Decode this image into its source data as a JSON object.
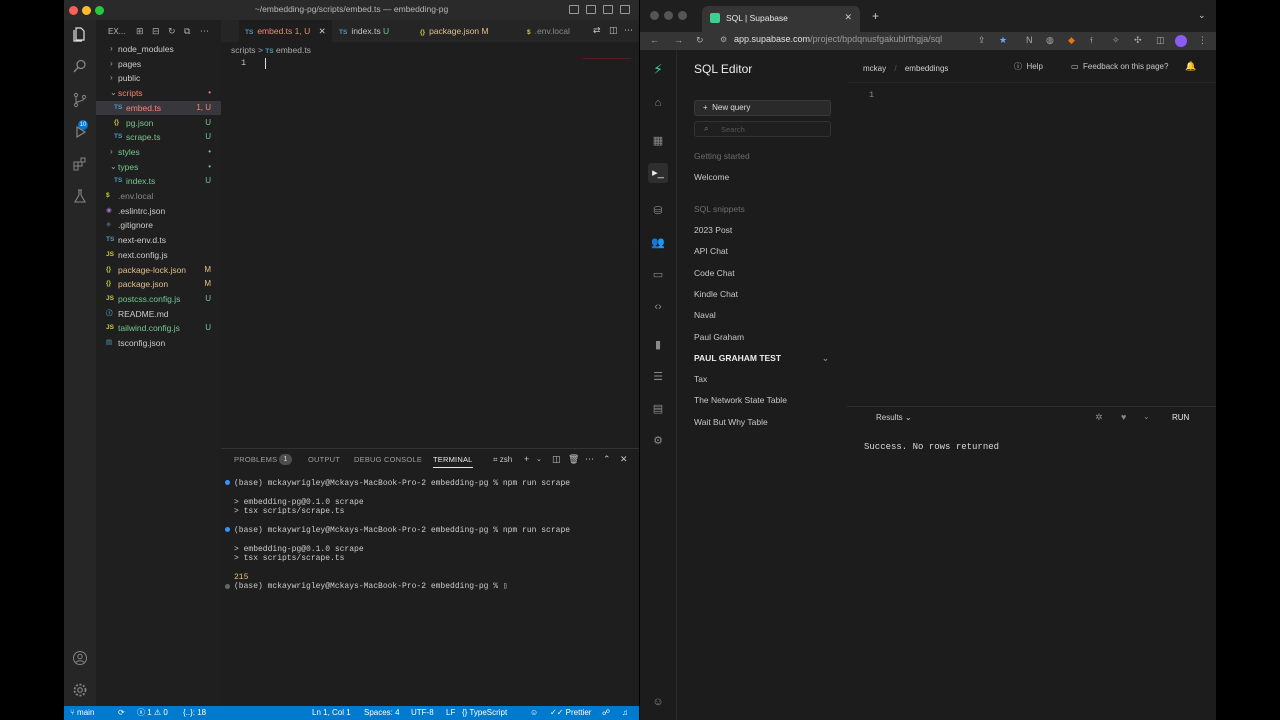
{
  "vscode": {
    "window_title": "~/embedding-pg/scripts/embed.ts — embedding-pg",
    "explorer_title": "EX...",
    "scm_badge": "10",
    "tree": [
      {
        "name": "node_modules",
        "type": "folder",
        "indent": 0,
        "status": ""
      },
      {
        "name": "pages",
        "type": "folder",
        "indent": 0,
        "status": ""
      },
      {
        "name": "public",
        "type": "folder",
        "indent": 0,
        "status": ""
      },
      {
        "name": "scripts",
        "type": "folder-open",
        "indent": 0,
        "status": "•",
        "color": "#f48771"
      },
      {
        "name": "embed.ts",
        "type": "ts",
        "indent": 1,
        "status": "1, U",
        "color": "#f48771",
        "selected": true
      },
      {
        "name": "pg.json",
        "type": "json",
        "indent": 1,
        "status": "U",
        "color": "#73c991"
      },
      {
        "name": "scrape.ts",
        "type": "ts",
        "indent": 1,
        "status": "U",
        "color": "#73c991"
      },
      {
        "name": "styles",
        "type": "folder",
        "indent": 0,
        "status": "•",
        "color": "#73c991"
      },
      {
        "name": "types",
        "type": "folder-open",
        "indent": 0,
        "status": "•",
        "color": "#73c991"
      },
      {
        "name": "index.ts",
        "type": "ts",
        "indent": 1,
        "status": "U",
        "color": "#73c991"
      },
      {
        "name": ".env.local",
        "type": "env",
        "indent": 0,
        "status": "",
        "color": "#8a8a8a"
      },
      {
        "name": ".eslintrc.json",
        "type": "eslint",
        "indent": 0,
        "status": ""
      },
      {
        "name": ".gitignore",
        "type": "git",
        "indent": 0,
        "status": ""
      },
      {
        "name": "next-env.d.ts",
        "type": "ts",
        "indent": 0,
        "status": ""
      },
      {
        "name": "next.config.js",
        "type": "js",
        "indent": 0,
        "status": ""
      },
      {
        "name": "package-lock.json",
        "type": "json",
        "indent": 0,
        "status": "M",
        "color": "#e2c08d"
      },
      {
        "name": "package.json",
        "type": "json",
        "indent": 0,
        "status": "M",
        "color": "#e2c08d"
      },
      {
        "name": "postcss.config.js",
        "type": "js",
        "indent": 0,
        "status": "U",
        "color": "#73c991"
      },
      {
        "name": "README.md",
        "type": "md",
        "indent": 0,
        "status": ""
      },
      {
        "name": "tailwind.config.js",
        "type": "js",
        "indent": 0,
        "status": "U",
        "color": "#73c991"
      },
      {
        "name": "tsconfig.json",
        "type": "tsconfig",
        "indent": 0,
        "status": ""
      }
    ],
    "tabs": [
      {
        "label": "embed.ts",
        "status": "1, U",
        "icon": "TS",
        "active": true
      },
      {
        "label": "index.ts",
        "status": "U",
        "icon": "TS"
      },
      {
        "label": "package.json",
        "status": "M",
        "icon": "{}"
      },
      {
        "label": ".env.local",
        "status": "",
        "icon": "$"
      }
    ],
    "breadcrumb": {
      "folder": "scripts",
      "sep": ">",
      "file_icon": "TS",
      "file": "embed.ts"
    },
    "line_number": "1",
    "panel_tabs": [
      "PROBLEMS",
      "OUTPUT",
      "DEBUG CONSOLE",
      "TERMINAL"
    ],
    "problems_count": "1",
    "terminal_shell": "zsh",
    "terminal_lines": [
      {
        "text": "(base) mckaywrigley@Mckays-MacBook-Pro-2 embedding-pg % npm run scrape",
        "dot": "#3794ff"
      },
      {
        "text": "",
        "dot": ""
      },
      {
        "text": "> embedding-pg@0.1.0 scrape",
        "dot": ""
      },
      {
        "text": "> tsx scripts/scrape.ts",
        "dot": ""
      },
      {
        "text": "",
        "dot": ""
      },
      {
        "text": "(base) mckaywrigley@Mckays-MacBook-Pro-2 embedding-pg % npm run scrape",
        "dot": "#3794ff"
      },
      {
        "text": "",
        "dot": ""
      },
      {
        "text": "> embedding-pg@0.1.0 scrape",
        "dot": ""
      },
      {
        "text": "> tsx scripts/scrape.ts",
        "dot": ""
      },
      {
        "text": "",
        "dot": ""
      },
      {
        "text": "215",
        "dot": "",
        "color": "#e5c07b"
      },
      {
        "text": "(base) mckaywrigley@Mckays-MacBook-Pro-2 embedding-pg % ▯",
        "dot": "#666666"
      }
    ],
    "status": {
      "branch": "main",
      "errors": "1",
      "warnings": "0",
      "extra": "{..}: 18",
      "position": "Ln 1, Col 1",
      "spaces": "Spaces: 4",
      "encoding": "UTF-8",
      "eol": "LF",
      "language": "TypeScript",
      "prettier": "Prettier"
    }
  },
  "chrome": {
    "tab_title": "SQL | Supabase",
    "url_domain": "app.supabase.com",
    "url_path": "/project/bpdqnusfgakublrthgja/sql"
  },
  "supabase": {
    "title": "SQL Editor",
    "new_query": "New query",
    "search_placeholder": "Search",
    "getting_started_header": "Getting started",
    "getting_started_items": [
      "Welcome"
    ],
    "snippets_header": "SQL snippets",
    "snippets": [
      {
        "name": "2023 Post"
      },
      {
        "name": "API Chat"
      },
      {
        "name": "Code Chat"
      },
      {
        "name": "Kindle Chat"
      },
      {
        "name": "Naval"
      },
      {
        "name": "Paul Graham"
      },
      {
        "name": "PAUL GRAHAM TEST",
        "active": true
      },
      {
        "name": "Tax"
      },
      {
        "name": "The Network State Table"
      },
      {
        "name": "Wait But Why Table"
      }
    ],
    "breadcrumb_org": "mckay",
    "breadcrumb_project": "embeddings",
    "help": "Help",
    "feedback": "Feedback on this page?",
    "editor_line": "1",
    "results_label": "Results",
    "run_label": "RUN",
    "result_message": "Success. No rows returned",
    "brand_color": "#3ecf8e"
  }
}
